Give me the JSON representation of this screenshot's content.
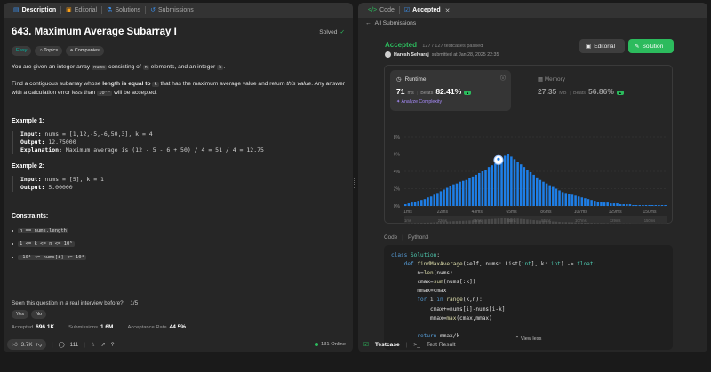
{
  "left_tabs": [
    {
      "label": "Description",
      "icon": "document-icon"
    },
    {
      "label": "Editorial",
      "icon": "book-icon"
    },
    {
      "label": "Solutions",
      "icon": "flask-icon"
    },
    {
      "label": "Submissions",
      "icon": "history-icon"
    }
  ],
  "problem": {
    "title": "643. Maximum Average Subarray I",
    "solved": "Solved",
    "chips": {
      "difficulty": "Easy",
      "topics": "Topics",
      "companies": "Companies"
    },
    "p1": {
      "a": "You are given an integer array ",
      "c1": "nums",
      "b": " consisting of ",
      "c2": "n",
      "c": " elements, and an integer ",
      "c3": "k",
      "d": "."
    },
    "p2": {
      "a": "Find a contiguous subarray whose ",
      "bold": "length is equal to",
      "c1": "k",
      "b": " that has the maximum average value and return ",
      "em": "this value",
      "c": ". Any answer with a calculation error less than ",
      "c2": "10⁻⁵",
      "d": " will be accepted."
    },
    "ex1": {
      "heading": "Example 1:",
      "input_label": "Input:",
      "input": "nums = [1,12,-5,-6,50,3], k = 4",
      "output_label": "Output:",
      "output": "12.75000",
      "expl_label": "Explanation:",
      "expl": "Maximum average is (12 - 5 - 6 + 50) / 4 = 51 / 4 = 12.75"
    },
    "ex2": {
      "heading": "Example 2:",
      "input_label": "Input:",
      "input": "nums = [5], k = 1",
      "output_label": "Output:",
      "output": "5.00000"
    },
    "constraints_heading": "Constraints:",
    "constraints": [
      "n == nums.length",
      "1 <= k <= n <= 10⁵",
      "-10⁴ <= nums[i] <= 10⁴"
    ],
    "seen": {
      "question": "Seen this question in a real interview before?",
      "count": "1/5",
      "yes": "Yes",
      "no": "No"
    },
    "stats": {
      "accepted_label": "Accepted",
      "accepted": "696.1K",
      "submissions_label": "Submissions",
      "submissions": "1.6M",
      "rate_label": "Acceptance Rate",
      "rate": "44.5%"
    }
  },
  "left_footer": {
    "likes": "3.7K",
    "comments": "111",
    "online": "131 Online"
  },
  "right_tabs": [
    {
      "label": "Code",
      "icon": "code-icon"
    },
    {
      "label": "Accepted",
      "icon": "check-icon"
    }
  ],
  "submission": {
    "back": "All Submissions",
    "status": "Accepted",
    "passed": "127 / 127 testcases passed",
    "user": "Haresh Selvaraj",
    "submitted": "submitted at Jan 28, 2025 22:35",
    "editorial_btn": "Editorial",
    "solution_btn": "Solution",
    "runtime": {
      "label": "Runtime",
      "value": "71",
      "unit": "ms",
      "beats_label": "Beats",
      "beats": "82.41%"
    },
    "analyze": "Analyze Complexity",
    "memory": {
      "label": "Memory",
      "value": "27.35",
      "unit": "MB",
      "beats_label": "Beats",
      "beats": "56.86%"
    },
    "code_label": "Code",
    "lang": "Python3",
    "view_less": "View less"
  },
  "chart_data": {
    "type": "bar",
    "title": "",
    "xlabel": "",
    "ylabel": "",
    "ylim": [
      0,
      8
    ],
    "yticks": [
      "8%",
      "6%",
      "4%",
      "2%",
      "0%"
    ],
    "x_tick_labels": [
      "1ms",
      "22ms",
      "43ms",
      "65ms",
      "86ms",
      "107ms",
      "129ms",
      "150ms"
    ],
    "highlight_index": 29,
    "values": [
      0.2,
      0.3,
      0.4,
      0.5,
      0.6,
      0.7,
      0.8,
      1.0,
      1.1,
      1.3,
      1.5,
      1.7,
      1.9,
      2.1,
      2.3,
      2.5,
      2.6,
      2.8,
      2.9,
      3.0,
      3.2,
      3.4,
      3.6,
      3.8,
      4.0,
      4.2,
      4.5,
      4.7,
      4.9,
      5.2,
      5.5,
      5.8,
      6.0,
      5.7,
      5.4,
      5.1,
      4.8,
      4.5,
      4.2,
      3.9,
      3.6,
      3.3,
      3.0,
      2.8,
      2.6,
      2.4,
      2.2,
      2.0,
      1.8,
      1.6,
      1.5,
      1.4,
      1.3,
      1.2,
      1.1,
      1.0,
      0.9,
      0.8,
      0.7,
      0.6,
      0.5,
      0.5,
      0.4,
      0.4,
      0.3,
      0.3,
      0.3,
      0.2,
      0.2,
      0.2,
      0.2,
      0.1,
      0.1,
      0.1,
      0.1,
      0.1,
      0.1,
      0.1,
      0.1,
      0.1,
      0.1,
      0.1
    ]
  },
  "code_lines": [
    [
      {
        "t": "class ",
        "c": "k"
      },
      {
        "t": "Solution",
        "c": "b"
      },
      {
        "t": ":",
        "c": ""
      }
    ],
    [
      {
        "t": "    def ",
        "c": "k"
      },
      {
        "t": "findMaxAverage",
        "c": "f"
      },
      {
        "t": "(self, nums: List[",
        "c": ""
      },
      {
        "t": "int",
        "c": "b"
      },
      {
        "t": "], k: ",
        "c": ""
      },
      {
        "t": "int",
        "c": "b"
      },
      {
        "t": ") -> ",
        "c": ""
      },
      {
        "t": "float",
        "c": "b"
      },
      {
        "t": ":",
        "c": ""
      }
    ],
    [
      {
        "t": "        n=",
        "c": ""
      },
      {
        "t": "len",
        "c": "f"
      },
      {
        "t": "(nums)",
        "c": ""
      }
    ],
    [
      {
        "t": "        cmax=",
        "c": ""
      },
      {
        "t": "sum",
        "c": "f"
      },
      {
        "t": "(nums[:k])",
        "c": ""
      }
    ],
    [
      {
        "t": "        mmax=cmax",
        "c": ""
      }
    ],
    [
      {
        "t": "        for ",
        "c": "k"
      },
      {
        "t": "i ",
        "c": ""
      },
      {
        "t": "in ",
        "c": "k"
      },
      {
        "t": "range",
        "c": "f"
      },
      {
        "t": "(k,n):",
        "c": ""
      }
    ],
    [
      {
        "t": "            cmax+=nums[i]-nums[i-k]",
        "c": ""
      }
    ],
    [
      {
        "t": "            mmax=",
        "c": ""
      },
      {
        "t": "max",
        "c": "f"
      },
      {
        "t": "(cmax,mmax)",
        "c": ""
      }
    ],
    [
      {
        "t": "",
        "c": ""
      }
    ],
    [
      {
        "t": "        return ",
        "c": "k"
      },
      {
        "t": "mmax/k",
        "c": ""
      }
    ]
  ],
  "right_footer": {
    "testcase": "Testcase",
    "result": "Test Result"
  },
  "colors": {
    "accent_green": "#2cbb5d",
    "bar_blue": "#1e7ee6",
    "orange": "#ffa116",
    "easy": "#00b8a3"
  }
}
